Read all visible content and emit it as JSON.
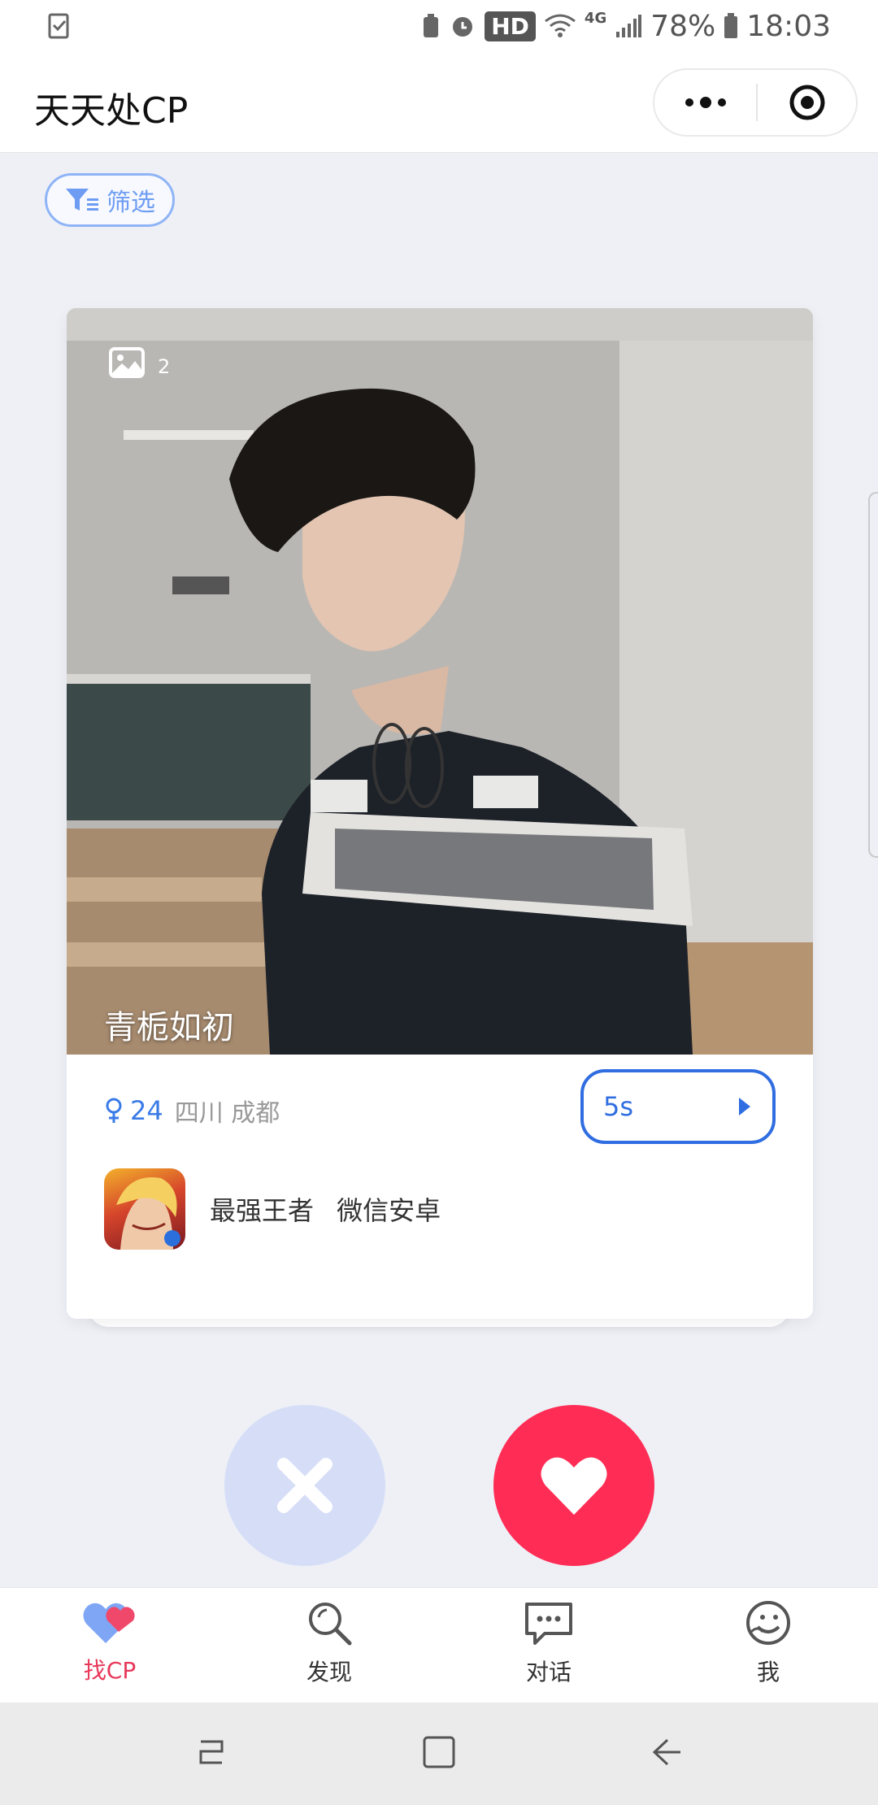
{
  "status_bar": {
    "hd": "HD",
    "network": "4G",
    "battery": "78%",
    "time": "18:03"
  },
  "header": {
    "title": "天天处CP"
  },
  "filter": {
    "label": "筛选"
  },
  "profile": {
    "photo_count": "2",
    "name": "青栀如初",
    "age": "24",
    "location": "四川 成都",
    "voice_duration": "5s",
    "game_tags": "最强王者 微信安卓"
  },
  "tabs": [
    {
      "label": "找CP",
      "active": true,
      "icon": "heart-icon"
    },
    {
      "label": "发现",
      "active": false,
      "icon": "search-icon"
    },
    {
      "label": "对话",
      "active": false,
      "icon": "chat-icon"
    },
    {
      "label": "我",
      "active": false,
      "icon": "profile-icon"
    }
  ],
  "colors": {
    "accent_red": "#ff2d55",
    "accent_blue": "#2f6de1",
    "dislike_bg": "#d6def7",
    "active_tab": "#e8385a"
  }
}
